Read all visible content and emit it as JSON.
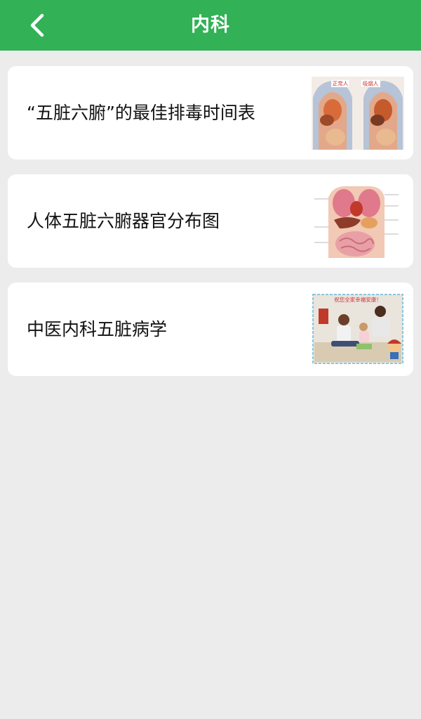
{
  "header": {
    "title": "内科",
    "back_icon": "chevron-left-icon",
    "background_color": "#32b156"
  },
  "articles": [
    {
      "title": "“五脏六腑”的最佳排毒时间表",
      "thumbnail_icon": "anatomy-comparison-image",
      "thumbnail_labels": [
        "正常人",
        "吸烟人"
      ]
    },
    {
      "title": "人体五脏六腑器官分布图",
      "thumbnail_icon": "internal-organs-diagram-image"
    },
    {
      "title": "中医内科五脏病学",
      "thumbnail_icon": "family-photo-image",
      "thumbnail_banner": "祝您全家幸福安康！"
    }
  ],
  "colors": {
    "page_background": "#ececec",
    "card_background": "#ffffff",
    "title_text": "#111111"
  }
}
